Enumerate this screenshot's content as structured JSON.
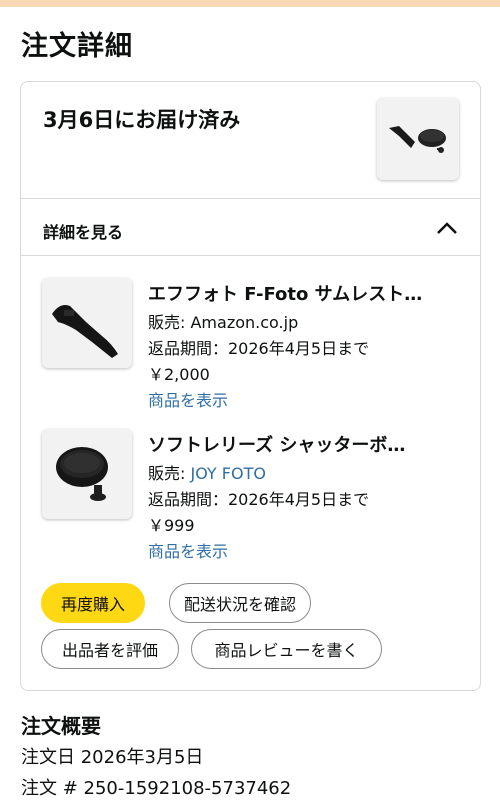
{
  "page": {
    "title": "注文詳細"
  },
  "delivery": {
    "status": "3月6日にお届け済み",
    "image_icon": "camera-accessory-thumbnail"
  },
  "details_toggle": {
    "label": "詳細を見る",
    "icon": "chevron-up-icon"
  },
  "items": [
    {
      "title": "エフフォト F-Foto サムレスト…",
      "seller_label": "販売: ",
      "seller": "Amazon.co.jp",
      "return_text": "返品期間：2026年4月5日まで",
      "price": "￥2,000",
      "view_link": "商品を表示",
      "image_icon": "thumb-rest-icon"
    },
    {
      "title": "ソフトレリーズ シャッターボ…",
      "seller_label": "販売: ",
      "seller": "JOY FOTO",
      "return_text": "返品期間：2026年4月5日まで",
      "price": "￥999",
      "view_link": "商品を表示",
      "image_icon": "shutter-button-icon"
    }
  ],
  "actions": {
    "buy_again": "再度購入",
    "track_package": "配送状況を確認",
    "rate_seller": "出品者を評価",
    "write_review": "商品レビューを書く"
  },
  "summary": {
    "title": "注文概要",
    "order_date": "注文日 2026年3月5日",
    "order_number": "注文 # 250-1592108-5737462"
  },
  "colors": {
    "accent_button": "#ffd814",
    "link": "#2f6ea8",
    "border": "#d5d9d9",
    "top_strip": "#f6d9b3"
  }
}
